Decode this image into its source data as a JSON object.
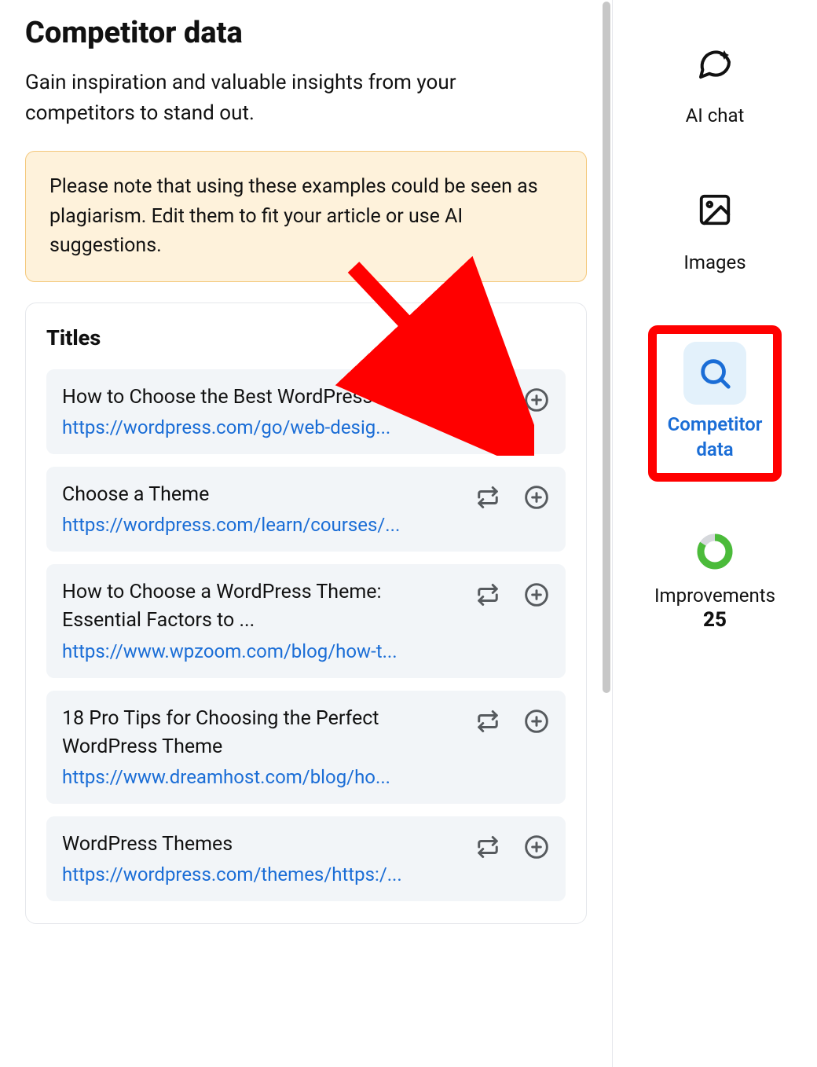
{
  "page": {
    "title": "Competitor data",
    "subtitle": "Gain inspiration and valuable insights from your competitors to stand out.",
    "notice": "Please note that using these examples could be seen as plagiarism. Edit them to fit your article or use AI suggestions."
  },
  "titles_section": {
    "heading": "Titles",
    "items": [
      {
        "title": "How to Choose the Best WordPress Theme",
        "url": "https://wordpress.com/go/web-desig..."
      },
      {
        "title": "Choose a Theme",
        "url": "https://wordpress.com/learn/courses/..."
      },
      {
        "title": "How to Choose a WordPress Theme: Essential Factors to ...",
        "url": "https://www.wpzoom.com/blog/how-t..."
      },
      {
        "title": "18 Pro Tips for Choosing the Perfect WordPress Theme",
        "url": "https://www.dreamhost.com/blog/ho..."
      },
      {
        "title": "WordPress Themes",
        "url": "https://wordpress.com/themes/https:/..."
      }
    ]
  },
  "sidebar": {
    "ai_chat": "AI chat",
    "images": "Images",
    "competitor_data": "Competitor data",
    "improvements_label": "Improvements",
    "improvements_count": "25"
  }
}
